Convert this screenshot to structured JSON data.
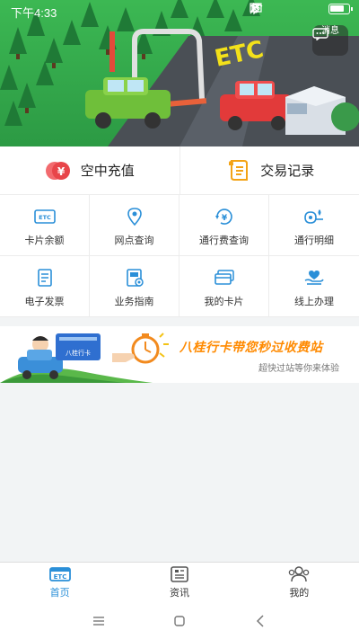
{
  "status_bar": {
    "time": "下午4:33",
    "battery_percent": 80
  },
  "header": {
    "message_label": "消息",
    "road_text": "ETC"
  },
  "top_actions": [
    {
      "label": "空中充值",
      "icon": "recharge-coin-icon"
    },
    {
      "label": "交易记录",
      "icon": "receipt-scroll-icon"
    }
  ],
  "services": [
    {
      "label": "卡片余额",
      "icon": "etc-card-icon",
      "icon_text": "ETC"
    },
    {
      "label": "网点查询",
      "icon": "location-pin-icon"
    },
    {
      "label": "通行费查询",
      "icon": "yen-circle-icon"
    },
    {
      "label": "通行明细",
      "icon": "route-detail-icon"
    },
    {
      "label": "电子发票",
      "icon": "invoice-icon"
    },
    {
      "label": "业务指南",
      "icon": "guide-book-icon"
    },
    {
      "label": "我的卡片",
      "icon": "cards-icon"
    },
    {
      "label": "线上办理",
      "icon": "hand-heart-icon"
    }
  ],
  "banner": {
    "slogan": "八桂行卡带您秒过收费站",
    "subtitle": "超快过站等你来体验",
    "card_text": "八桂行卡"
  },
  "bottom_nav": [
    {
      "label": "首页",
      "icon": "etc-home-icon",
      "icon_text": "ETC",
      "active": true
    },
    {
      "label": "资讯",
      "icon": "news-icon",
      "active": false
    },
    {
      "label": "我的",
      "icon": "profile-group-icon",
      "active": false
    }
  ],
  "colors": {
    "accent": "#2a8fd8",
    "hero_green": "#2fa84a",
    "banner_orange": "#ff8a00",
    "recharge_red": "#e8454a",
    "record_orange": "#f3a316"
  }
}
